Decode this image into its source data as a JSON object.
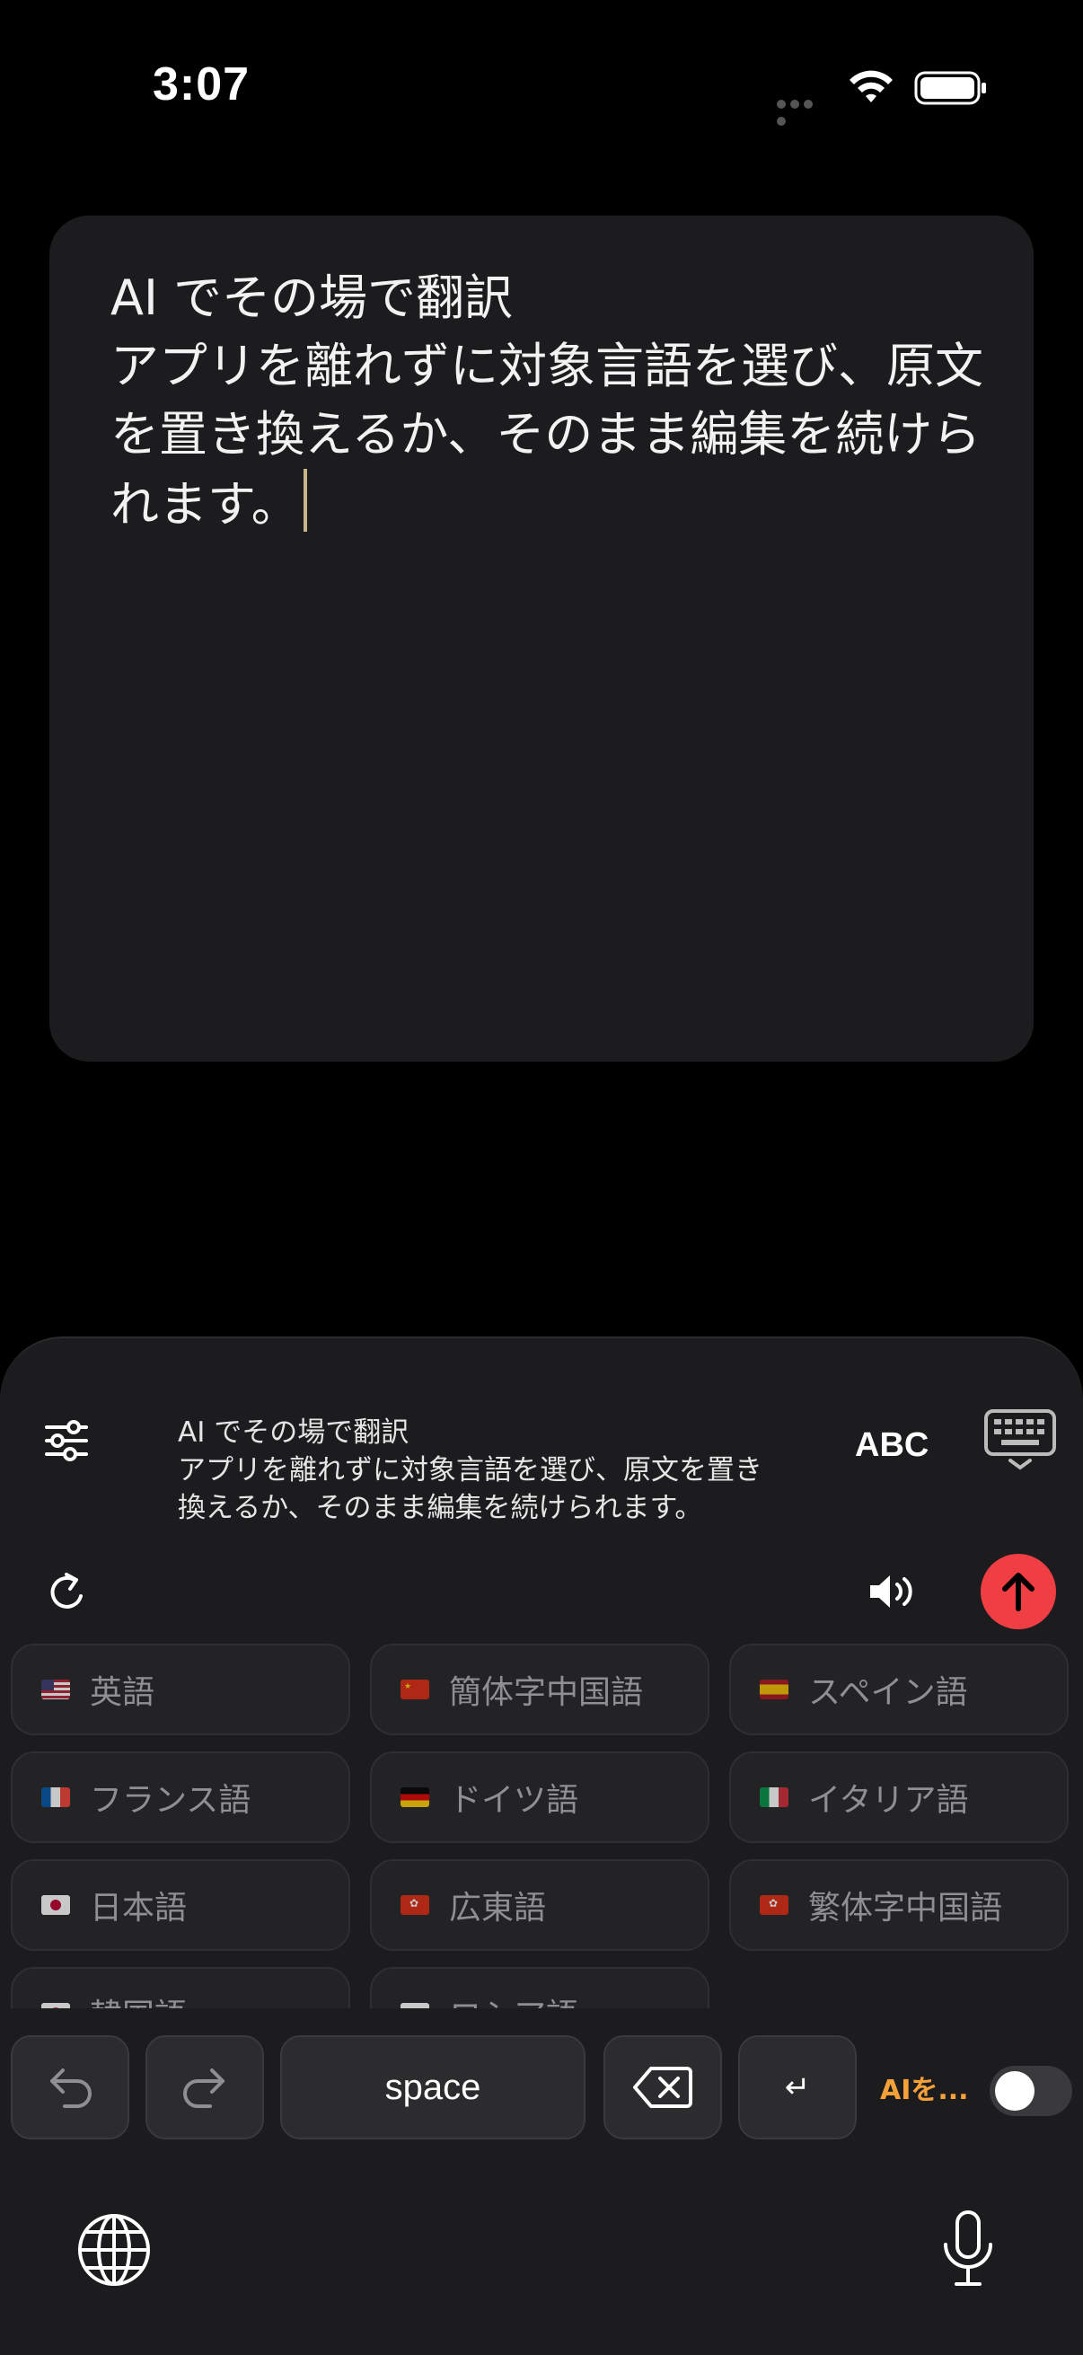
{
  "status_bar": {
    "time": "3:07"
  },
  "editor": {
    "text": "AI でその場で翻訳\nアプリを離れずに対象言語を選び、原文を置き換えるか、そのまま編集を続けられます。"
  },
  "keyboard": {
    "preview_text": "AI でその場で翻訳\nアプリを離れずに対象言語を選び、原文を置き換えるか、そのまま編集を続けられます。",
    "mode_label": "ABC",
    "languages": [
      {
        "label": "英語",
        "flag": "us"
      },
      {
        "label": "簡体字中国語",
        "flag": "cn"
      },
      {
        "label": "スペイン語",
        "flag": "es"
      },
      {
        "label": "フランス語",
        "flag": "fr"
      },
      {
        "label": "ドイツ語",
        "flag": "de"
      },
      {
        "label": "イタリア語",
        "flag": "it"
      },
      {
        "label": "日本語",
        "flag": "jp"
      },
      {
        "label": "広東語",
        "flag": "hk"
      },
      {
        "label": "繁体字中国語",
        "flag": "hk"
      },
      {
        "label": "韓国語",
        "flag": "kr"
      },
      {
        "label": "ロシア語",
        "flag": "ru"
      }
    ],
    "space_label": "space",
    "return_label": "↵",
    "ai_toggle_label": "AIを...",
    "ai_toggle_on": false,
    "colors": {
      "accent_send": "#ef3e44",
      "ai_label": "#f5a13a"
    }
  }
}
